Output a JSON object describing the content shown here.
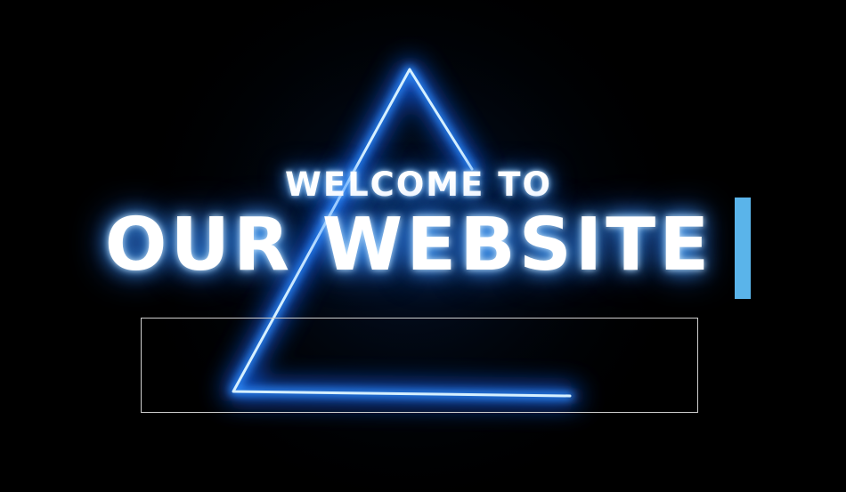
{
  "hero": {
    "line1": "WELCOME TO",
    "line2": "OUR WEBSITE"
  },
  "colors": {
    "background": "#000000",
    "neon_blue": "#1e90ff",
    "cursor_bar": "#5ab4ea",
    "text": "#ffffff"
  }
}
